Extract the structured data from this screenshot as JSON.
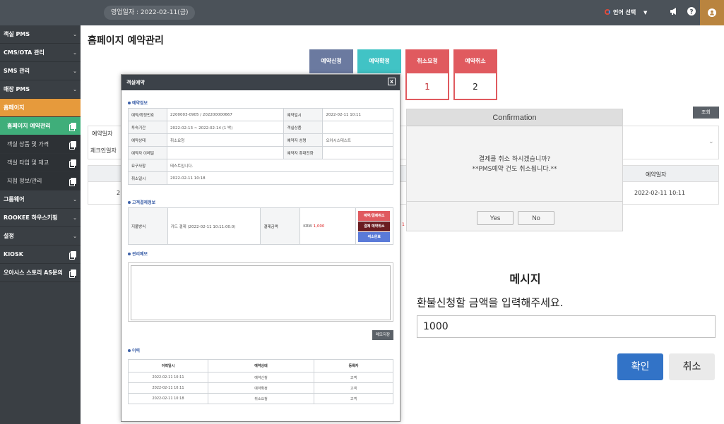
{
  "header": {
    "business_date": "영업일자 : 2022-02-11(금)",
    "language_label": "언어 선택"
  },
  "sidebar": {
    "items": [
      {
        "label": "객실 PMS"
      },
      {
        "label": "CMS/OTA 관리"
      },
      {
        "label": "SMS 관리"
      },
      {
        "label": "매장 PMS"
      },
      {
        "label": "홈페이지"
      },
      {
        "label": "홈페이지 예약관리"
      },
      {
        "label": "객실 상품 및 가격"
      },
      {
        "label": "객실 타입 및 재고"
      },
      {
        "label": "지점 정보/관리"
      },
      {
        "label": "그룹웨어"
      },
      {
        "label": "ROOKEE 하우스키핑"
      },
      {
        "label": "설정"
      },
      {
        "label": "KIOSK"
      },
      {
        "label": "오아시스 스토리 AS문의"
      }
    ]
  },
  "page": {
    "title": "홈페이지 예약관리",
    "status_tabs": [
      {
        "label": "예약신청",
        "color": "#6b7aa0"
      },
      {
        "label": "예약확정",
        "color": "#41c3c5"
      },
      {
        "label": "취소요청",
        "color": "#e05a5f",
        "count": "1"
      },
      {
        "label": "예약취소",
        "color": "#e05a5f",
        "count": "2"
      }
    ],
    "search_button": "조회",
    "filter_reservation_date": "예약일자",
    "filter_checkin_date": "체크인일자",
    "table_header_date": "예약일자",
    "table_row_date": "2022-02-11 10:11",
    "table_row_prefix": "2"
  },
  "modal": {
    "title": "객실예약",
    "close": "x",
    "reservation_section": "예약정보",
    "rows": [
      {
        "l1": "예약/확정번호",
        "v1": "2200003-0905 / 202200000667",
        "l2": "예약일시",
        "v2": "2022-02-11 10:11"
      },
      {
        "l1": "투숙기간",
        "v1": "2022-02-13 ~ 2022-02-14 (1 박)",
        "l2": "객실상품",
        "v2": ""
      },
      {
        "l1": "예약상태",
        "v1": "취소요청",
        "l2": "예약자 성명",
        "v2": "오아시스테스트"
      },
      {
        "l1": "예약자 이메일",
        "v1": "",
        "l2": "예약자 휴대전화",
        "v2": ""
      },
      {
        "l1": "요구사항",
        "v1": "테스트입니다."
      },
      {
        "l1": "취소일시",
        "v1": "2022-02-11 10:18"
      }
    ],
    "payment_section": "고객결제정보",
    "payment": {
      "method_label": "지불방식",
      "method_value": "카드 결제 (2022-02-11 10:11:00.0)",
      "amount_label": "결제금액",
      "amount_currency": "KRW",
      "amount_value": "1,000",
      "btn_cancel_reservation": "예약/결제취소",
      "btn_cancel_payment": "결제 예약취소",
      "btn_cancel_done": "취소완료"
    },
    "memo_section": "관리메모",
    "memo_save": "메모저장",
    "history_section": "이력",
    "history": {
      "headers": [
        "이력일시",
        "예약상태",
        "등록자"
      ],
      "rows": [
        [
          "2022-02-11 10:11",
          "예약신청",
          "고객"
        ],
        [
          "2022-02-11 10:11",
          "예약확정",
          "고객"
        ],
        [
          "2022-02-11 10:18",
          "취소요청",
          "고객"
        ]
      ]
    }
  },
  "confirmation": {
    "title": "Confirmation",
    "line1": "결제를 취소 하시겠습니까?",
    "line2": "**PMS예약 건도 취소됩니다.**",
    "yes": "Yes",
    "no": "No"
  },
  "refund_prompt": {
    "title": "메시지",
    "label": "환불신청할 금액을 입력해주세요.",
    "value": "1000",
    "ok": "확인",
    "cancel": "취소"
  }
}
